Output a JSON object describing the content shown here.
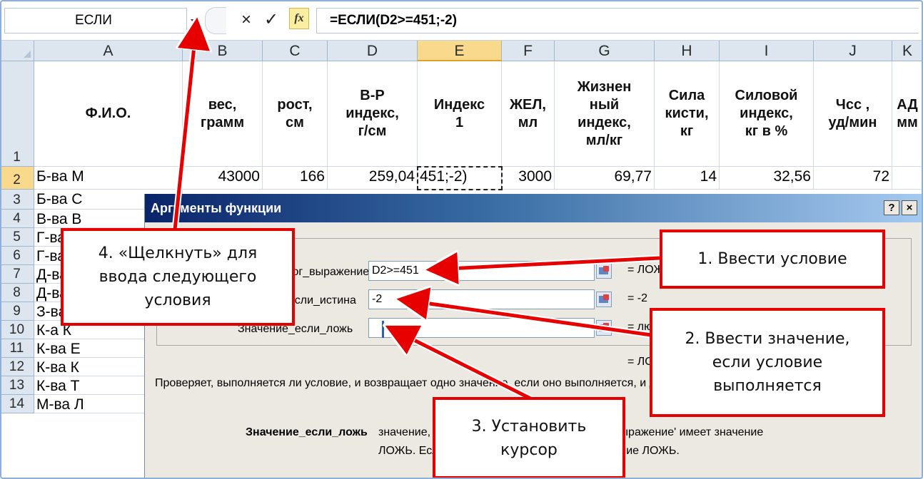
{
  "formula_bar": {
    "name_box": "ЕСЛИ",
    "cancel_icon": "×",
    "enter_icon": "✓",
    "fx_icon": "fx",
    "formula": "=ЕСЛИ(D2>=451;-2)"
  },
  "sheet": {
    "columns": [
      "A",
      "B",
      "C",
      "D",
      "E",
      "F",
      "G",
      "H",
      "I",
      "J",
      "K"
    ],
    "active_column": "E",
    "row_numbers": [
      "1",
      "2",
      "3",
      "4",
      "5",
      "6",
      "7",
      "8",
      "9",
      "10",
      "11",
      "12",
      "13",
      "14"
    ],
    "header_row": [
      "Ф.И.О.",
      "вес,\nграмм",
      "рост,\nсм",
      "В-Р\nиндекс,\nг/см",
      "Индекс\n1",
      "ЖЕЛ,\nмл",
      "Жизнен\nный\nиндекс,\nмл/кг",
      "Сила\nкисти,\nкг",
      "Силовой\nиндекс,\nкг в %",
      "Чсс ,\nуд/мин",
      "АД\nмм"
    ],
    "row2": [
      "Б-ва М",
      "43000",
      "166",
      "259,04",
      "451;-2)",
      "3000",
      "69,77",
      "14",
      "32,56",
      "72",
      ""
    ],
    "names": [
      "Б-ва М",
      "Б-ва С",
      "В-ва В",
      "Г-ва",
      "Г-ва",
      "Д-ва",
      "Д-ва Л",
      "З-ва К",
      "К-а К",
      "К-ва Е",
      "К-ва К",
      "К-ва Т",
      "М-ва Л"
    ]
  },
  "dialog": {
    "title": "Аргументы функции",
    "help_button": "?",
    "close_button": "×",
    "args": [
      {
        "label": "Лог_выражение",
        "value": "D2>=451",
        "result": "= ЛОЖЬ"
      },
      {
        "label": "Значение_если_истина",
        "value": "-2",
        "result": "= -2"
      },
      {
        "label": "Значение_если_ложь",
        "value": "",
        "result": "= любое"
      }
    ],
    "total_result": "= ЛОЖЬ",
    "description": "Проверяет, выполняется ли условие, и возвращает одно значение, если оно выполняется, и другое значение, если нет.",
    "param_name": "Значение_если_ложь",
    "param_desc_line1": "значение, которое возвращается, если 'лог_выражение' имеет значение",
    "param_desc_line2": "ЛОЖЬ. Если не указано, возвращается значение ЛОЖЬ."
  },
  "callouts": {
    "step1": "1. Ввести условие",
    "step2": "2. Ввести значение,\nесли условие\nвыполняется",
    "step3": "3. Установить\nкурсор",
    "step4": "4. «Щелкнуть» для\nввода следующего\nусловия"
  },
  "colors": {
    "callout_border": "#e60000",
    "arrow": "#e60000",
    "dialog_title_start": "#0a246a",
    "active_header": "#f9d98b"
  }
}
